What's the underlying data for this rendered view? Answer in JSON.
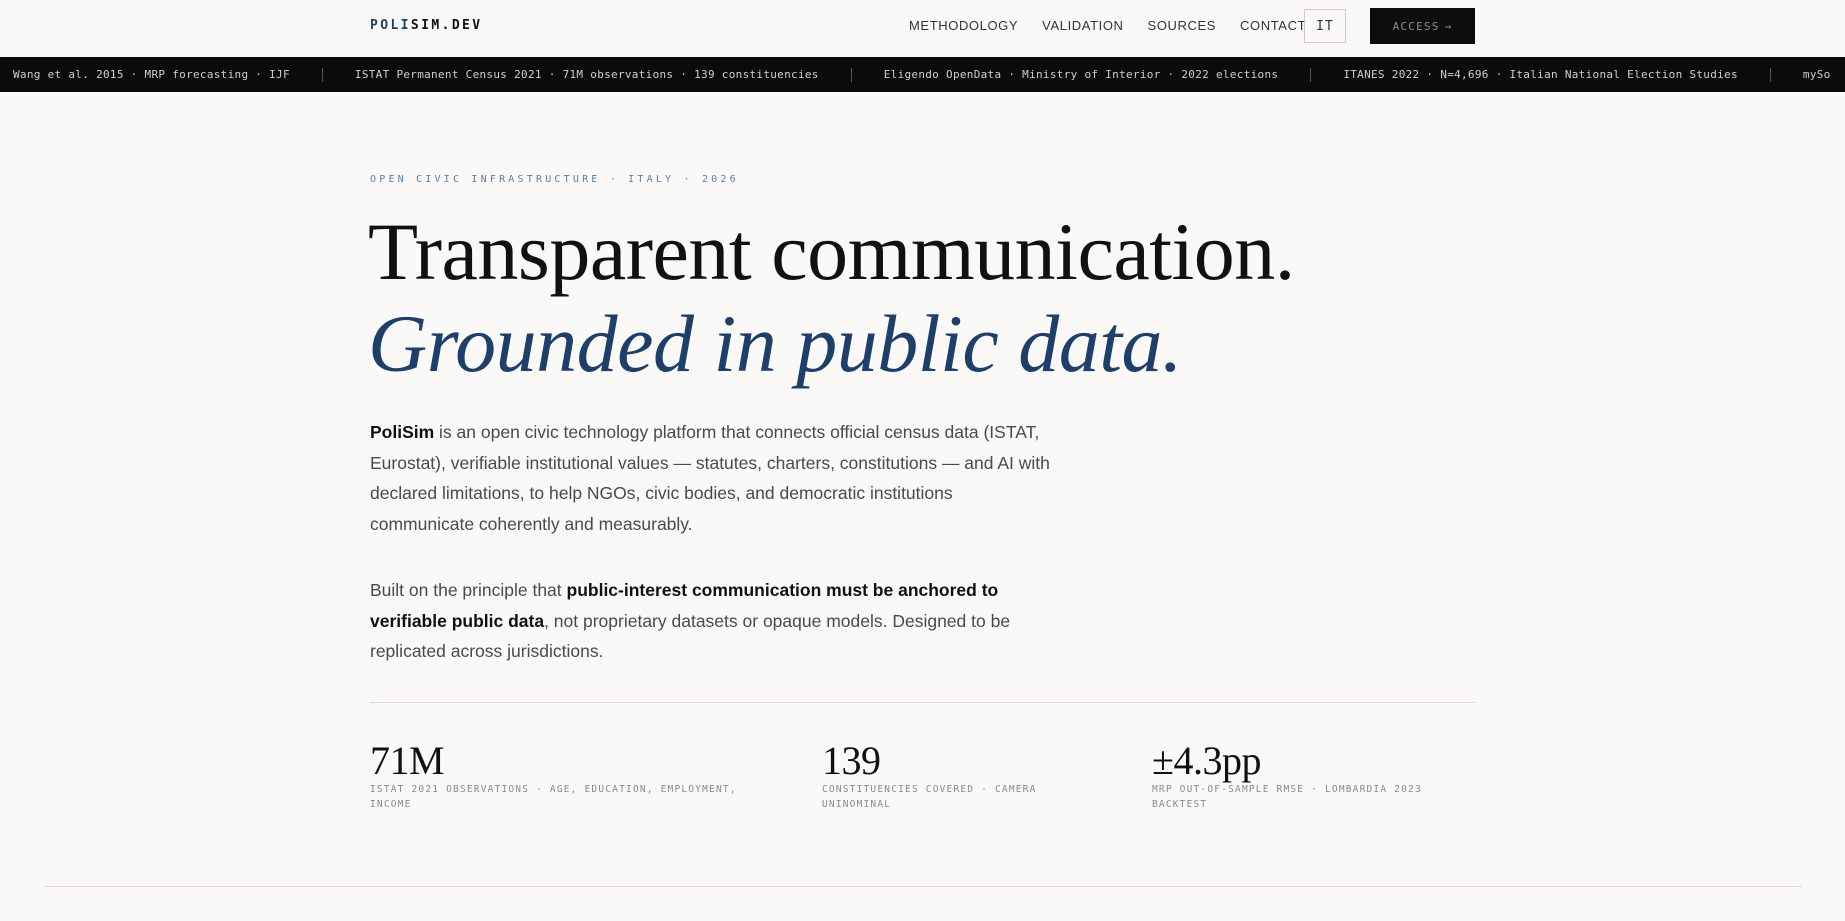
{
  "header": {
    "logo_prefix": "POLI",
    "logo_suffix": "SIM.DEV",
    "nav": [
      "METHODOLOGY",
      "VALIDATION",
      "SOURCES",
      "CONTACT"
    ],
    "lang": "IT",
    "access_label": "ACCESS",
    "access_arrow": "→"
  },
  "ticker": {
    "items": [
      "Wang et al. 2015 · MRP forecasting · IJF",
      "ISTAT Permanent Census 2021 · 71M observations · 139 constituencies",
      "Eligendo OpenData · Ministry of Interior · 2022 elections",
      "ITANES 2022 · N=4,696 · Italian National Election Studies",
      "mySo"
    ]
  },
  "hero": {
    "eyebrow": "OPEN CIVIC INFRASTRUCTURE · ITALY · 2026",
    "headline_line1": "Transparent communication.",
    "headline_line2": "Grounded in public data.",
    "para1_strong": "PoliSim",
    "para1_text": " is an open civic technology platform that connects official census data (ISTAT, Eurostat), verifiable institutional values — statutes, charters, constitutions — and AI with declared limitations, to help NGOs, civic bodies, and democratic institutions communicate coherently and measurably.",
    "para2_pre": "Built on the principle that ",
    "para2_strong": "public-interest communication must be anchored to verifiable public data",
    "para2_post": ", not proprietary datasets or opaque models. Designed to be replicated across jurisdictions."
  },
  "stats": [
    {
      "value": "71M",
      "label": "ISTAT 2021 OBSERVATIONS · AGE, EDUCATION, EMPLOYMENT, INCOME"
    },
    {
      "value": "139",
      "label": "CONSTITUENCIES COVERED · CAMERA UNINOMINAL"
    },
    {
      "value": "±4.3pp",
      "label": "MRP OUT-OF-SAMPLE RMSE · LOMBARDIA 2023 BACKTEST"
    }
  ]
}
